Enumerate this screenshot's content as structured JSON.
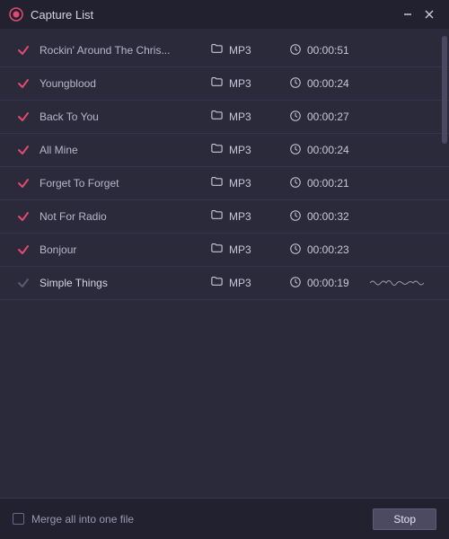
{
  "window": {
    "title": "Capture List",
    "minimize_label": "Minimize",
    "close_label": "Close"
  },
  "tracks": [
    {
      "name": "Rockin' Around The Chris...",
      "format": "MP3",
      "duration": "00:00:51",
      "status": "done"
    },
    {
      "name": "Youngblood",
      "format": "MP3",
      "duration": "00:00:24",
      "status": "done"
    },
    {
      "name": "Back To You",
      "format": "MP3",
      "duration": "00:00:27",
      "status": "done"
    },
    {
      "name": "All Mine",
      "format": "MP3",
      "duration": "00:00:24",
      "status": "done"
    },
    {
      "name": "Forget To Forget",
      "format": "MP3",
      "duration": "00:00:21",
      "status": "done"
    },
    {
      "name": "Not For Radio",
      "format": "MP3",
      "duration": "00:00:32",
      "status": "done"
    },
    {
      "name": "Bonjour",
      "format": "MP3",
      "duration": "00:00:23",
      "status": "done"
    },
    {
      "name": "Simple Things",
      "format": "MP3",
      "duration": "00:00:19",
      "status": "recording"
    }
  ],
  "footer": {
    "merge_label": "Merge all into one file",
    "merge_checked": false,
    "stop_label": "Stop"
  },
  "colors": {
    "bg": "#2b2a3a",
    "bg_dark": "#22212f",
    "accent_red": "#e34a6f",
    "text": "#c8c6d8",
    "text_dim": "#9a98b0",
    "divider": "#35344a"
  }
}
